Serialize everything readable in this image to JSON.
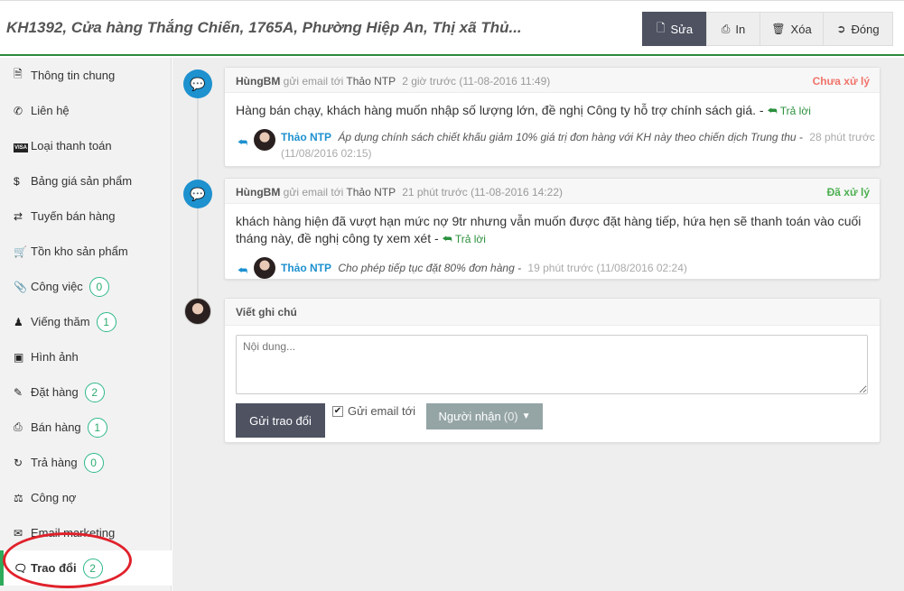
{
  "header": {
    "title": "KH1392, Cửa hàng Thắng Chiến, 1765A, Phường Hiệp An, Thị xã Thủ...",
    "buttons": [
      {
        "label": "Sửa",
        "icon": "file-icon"
      },
      {
        "label": "In",
        "icon": "print-icon"
      },
      {
        "label": "Xóa",
        "icon": "trash-icon"
      },
      {
        "label": "Đóng",
        "icon": "sign-out-icon"
      }
    ]
  },
  "sidebar": {
    "items": [
      {
        "label": "Thông tin chung",
        "icon": "file-text-icon"
      },
      {
        "label": "Liên hệ",
        "icon": "phone-icon"
      },
      {
        "label": "Loại thanh toán",
        "icon": "visa-card-icon"
      },
      {
        "label": "Bảng giá sản phẩm",
        "icon": "dollar-icon"
      },
      {
        "label": "Tuyến bán hàng",
        "icon": "random-icon"
      },
      {
        "label": "Tồn kho sản phẩm",
        "icon": "cart-icon"
      },
      {
        "label": "Công việc",
        "icon": "paperclip-icon",
        "badge": "0"
      },
      {
        "label": "Viếng thăm",
        "icon": "street-view-icon",
        "badge": "1"
      },
      {
        "label": "Hình ảnh",
        "icon": "image-icon"
      },
      {
        "label": "Đặt hàng",
        "icon": "edit-icon",
        "badge": "2"
      },
      {
        "label": "Bán hàng",
        "icon": "fax-icon",
        "badge": "1"
      },
      {
        "label": "Trả hàng",
        "icon": "refresh-icon",
        "badge": "0"
      },
      {
        "label": "Công nợ",
        "icon": "balance-scale-icon"
      },
      {
        "label": "Email marketing",
        "icon": "envelope-icon"
      },
      {
        "label": "Trao đổi",
        "icon": "comment-icon",
        "badge": "2",
        "active": true
      }
    ]
  },
  "messages": [
    {
      "author": "HùngBM",
      "action": "gửi email tới",
      "recipient": "Thảo NTP",
      "time": "2 giờ trước (11-08-2016 11:49)",
      "status": "Chưa xử lý",
      "status_color": "#f0736a",
      "body": "Hàng bán chạy, khách hàng muốn nhập số lượng lớn, đề nghị Công ty hỗ trợ chính sách giá. -",
      "reply_label": "Trả lời",
      "reply": {
        "name": "Thảo NTP",
        "text": "Áp dụng chính sách chiết khấu giảm 10% giá trị đơn hàng với KH này theo chiến dịch Trung thu -",
        "time": "28 phút trước",
        "time2": "(11/08/2016 02:15)"
      }
    },
    {
      "author": "HùngBM",
      "action": "gửi email tới",
      "recipient": "Thảo NTP",
      "time": "21 phút trước (11-08-2016 14:22)",
      "status": "Đã xử lý",
      "status_color": "#4caf50",
      "body": "khách hàng hiện đã vượt hạn mức nợ 9tr nhưng vẫn muốn được đặt hàng tiếp, hứa hẹn sẽ thanh toán vào cuối tháng này, đề nghị công ty xem xét -",
      "reply_label": "Trả lời",
      "reply": {
        "name": "Thảo NTP",
        "text": "Cho phép tiếp tục đặt 80% đơn hàng -",
        "time": "19 phút trước (11/08/2016 02:24)"
      }
    }
  ],
  "note": {
    "title": "Viết ghi chú",
    "placeholder": "Nội dung...",
    "send_label": "Gửi trao đổi",
    "checkbox_label": "Gửi email tới",
    "checkbox_checked": true,
    "recipient_label": "Người nhận",
    "recipient_count": "(0)"
  },
  "colors": {
    "accent_green": "#2e8b3c",
    "timeline_blue": "#1e91cf",
    "dark_button": "#4e5261",
    "annotation_red": "#e0212b"
  }
}
